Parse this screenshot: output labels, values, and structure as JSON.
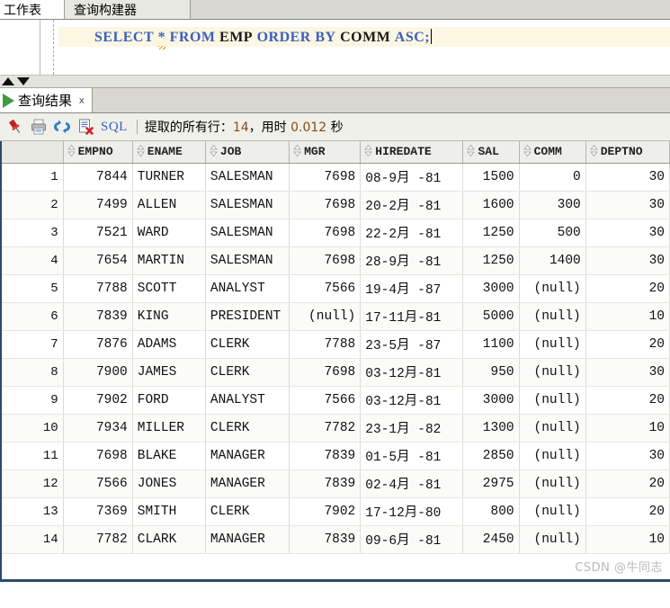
{
  "window": {
    "tabs": [
      {
        "label": "工作表",
        "active": true
      },
      {
        "label": "查询构建器",
        "active": false
      }
    ]
  },
  "editor": {
    "statement": "SELECT * FROM EMP ORDER BY COMM ASC;",
    "tokens": [
      {
        "text": "SELECT",
        "type": "keyword"
      },
      {
        "text": " ",
        "type": "plain"
      },
      {
        "text": "*",
        "type": "star"
      },
      {
        "text": " ",
        "type": "plain"
      },
      {
        "text": "FROM",
        "type": "keyword"
      },
      {
        "text": " ",
        "type": "plain"
      },
      {
        "text": "EMP",
        "type": "identifier"
      },
      {
        "text": " ",
        "type": "plain"
      },
      {
        "text": "ORDER",
        "type": "keyword"
      },
      {
        "text": " ",
        "type": "plain"
      },
      {
        "text": "BY",
        "type": "keyword"
      },
      {
        "text": " ",
        "type": "plain"
      },
      {
        "text": "COMM",
        "type": "identifier"
      },
      {
        "text": " ",
        "type": "plain"
      },
      {
        "text": "ASC",
        "type": "keyword"
      },
      {
        "text": ";",
        "type": "plain"
      }
    ],
    "keyword_color": "#3a5fbf",
    "identifier_color": "#1a1a1a",
    "line_highlight_color": "#fdf6e3"
  },
  "splitter": {
    "up_arrow": "scroll-up-arrow",
    "down_arrow": "scroll-down-arrow"
  },
  "results_tab": {
    "label": "查询结果",
    "close_label": "x",
    "run_icon": "play-icon"
  },
  "toolbar": {
    "buttons": [
      {
        "icon": "pin-icon",
        "name": "pin-result-button"
      },
      {
        "icon": "printer-icon",
        "name": "print-button"
      },
      {
        "icon": "refresh-icon",
        "name": "refresh-button"
      },
      {
        "icon": "clear-results-icon",
        "name": "clear-results-button"
      }
    ],
    "sql_label": "SQL",
    "status_prefix": "提取的所有行：",
    "status_rows": "14",
    "status_mid": "，用时 ",
    "status_time": "0.012",
    "status_suffix": " 秒"
  },
  "grid": {
    "row_number_header": "",
    "columns": [
      {
        "label": "EMPNO",
        "align": "num"
      },
      {
        "label": "ENAME",
        "align": "txt"
      },
      {
        "label": "JOB",
        "align": "txt"
      },
      {
        "label": "MGR",
        "align": "num"
      },
      {
        "label": "HIREDATE",
        "align": "txt"
      },
      {
        "label": "SAL",
        "align": "num"
      },
      {
        "label": "COMM",
        "align": "num"
      },
      {
        "label": "DEPTNO",
        "align": "num"
      }
    ],
    "rows": [
      {
        "n": "1",
        "EMPNO": "7844",
        "ENAME": "TURNER",
        "JOB": "SALESMAN",
        "MGR": "7698",
        "HIREDATE": "08-9月 -81",
        "SAL": "1500",
        "COMM": "0",
        "DEPTNO": "30"
      },
      {
        "n": "2",
        "EMPNO": "7499",
        "ENAME": "ALLEN",
        "JOB": "SALESMAN",
        "MGR": "7698",
        "HIREDATE": "20-2月 -81",
        "SAL": "1600",
        "COMM": "300",
        "DEPTNO": "30"
      },
      {
        "n": "3",
        "EMPNO": "7521",
        "ENAME": "WARD",
        "JOB": "SALESMAN",
        "MGR": "7698",
        "HIREDATE": "22-2月 -81",
        "SAL": "1250",
        "COMM": "500",
        "DEPTNO": "30"
      },
      {
        "n": "4",
        "EMPNO": "7654",
        "ENAME": "MARTIN",
        "JOB": "SALESMAN",
        "MGR": "7698",
        "HIREDATE": "28-9月 -81",
        "SAL": "1250",
        "COMM": "1400",
        "DEPTNO": "30"
      },
      {
        "n": "5",
        "EMPNO": "7788",
        "ENAME": "SCOTT",
        "JOB": "ANALYST",
        "MGR": "7566",
        "HIREDATE": "19-4月 -87",
        "SAL": "3000",
        "COMM": "(null)",
        "DEPTNO": "20"
      },
      {
        "n": "6",
        "EMPNO": "7839",
        "ENAME": "KING",
        "JOB": "PRESIDENT",
        "MGR": "(null)",
        "HIREDATE": "17-11月-81",
        "SAL": "5000",
        "COMM": "(null)",
        "DEPTNO": "10"
      },
      {
        "n": "7",
        "EMPNO": "7876",
        "ENAME": "ADAMS",
        "JOB": "CLERK",
        "MGR": "7788",
        "HIREDATE": "23-5月 -87",
        "SAL": "1100",
        "COMM": "(null)",
        "DEPTNO": "20"
      },
      {
        "n": "8",
        "EMPNO": "7900",
        "ENAME": "JAMES",
        "JOB": "CLERK",
        "MGR": "7698",
        "HIREDATE": "03-12月-81",
        "SAL": "950",
        "COMM": "(null)",
        "DEPTNO": "30"
      },
      {
        "n": "9",
        "EMPNO": "7902",
        "ENAME": "FORD",
        "JOB": "ANALYST",
        "MGR": "7566",
        "HIREDATE": "03-12月-81",
        "SAL": "3000",
        "COMM": "(null)",
        "DEPTNO": "20"
      },
      {
        "n": "10",
        "EMPNO": "7934",
        "ENAME": "MILLER",
        "JOB": "CLERK",
        "MGR": "7782",
        "HIREDATE": "23-1月 -82",
        "SAL": "1300",
        "COMM": "(null)",
        "DEPTNO": "10"
      },
      {
        "n": "11",
        "EMPNO": "7698",
        "ENAME": "BLAKE",
        "JOB": "MANAGER",
        "MGR": "7839",
        "HIREDATE": "01-5月 -81",
        "SAL": "2850",
        "COMM": "(null)",
        "DEPTNO": "30"
      },
      {
        "n": "12",
        "EMPNO": "7566",
        "ENAME": "JONES",
        "JOB": "MANAGER",
        "MGR": "7839",
        "HIREDATE": "02-4月 -81",
        "SAL": "2975",
        "COMM": "(null)",
        "DEPTNO": "20"
      },
      {
        "n": "13",
        "EMPNO": "7369",
        "ENAME": "SMITH",
        "JOB": "CLERK",
        "MGR": "7902",
        "HIREDATE": "17-12月-80",
        "SAL": "800",
        "COMM": "(null)",
        "DEPTNO": "20"
      },
      {
        "n": "14",
        "EMPNO": "7782",
        "ENAME": "CLARK",
        "JOB": "MANAGER",
        "MGR": "7839",
        "HIREDATE": "09-6月 -81",
        "SAL": "2450",
        "COMM": "(null)",
        "DEPTNO": "10"
      }
    ]
  },
  "watermark": "CSDN @牛同志"
}
